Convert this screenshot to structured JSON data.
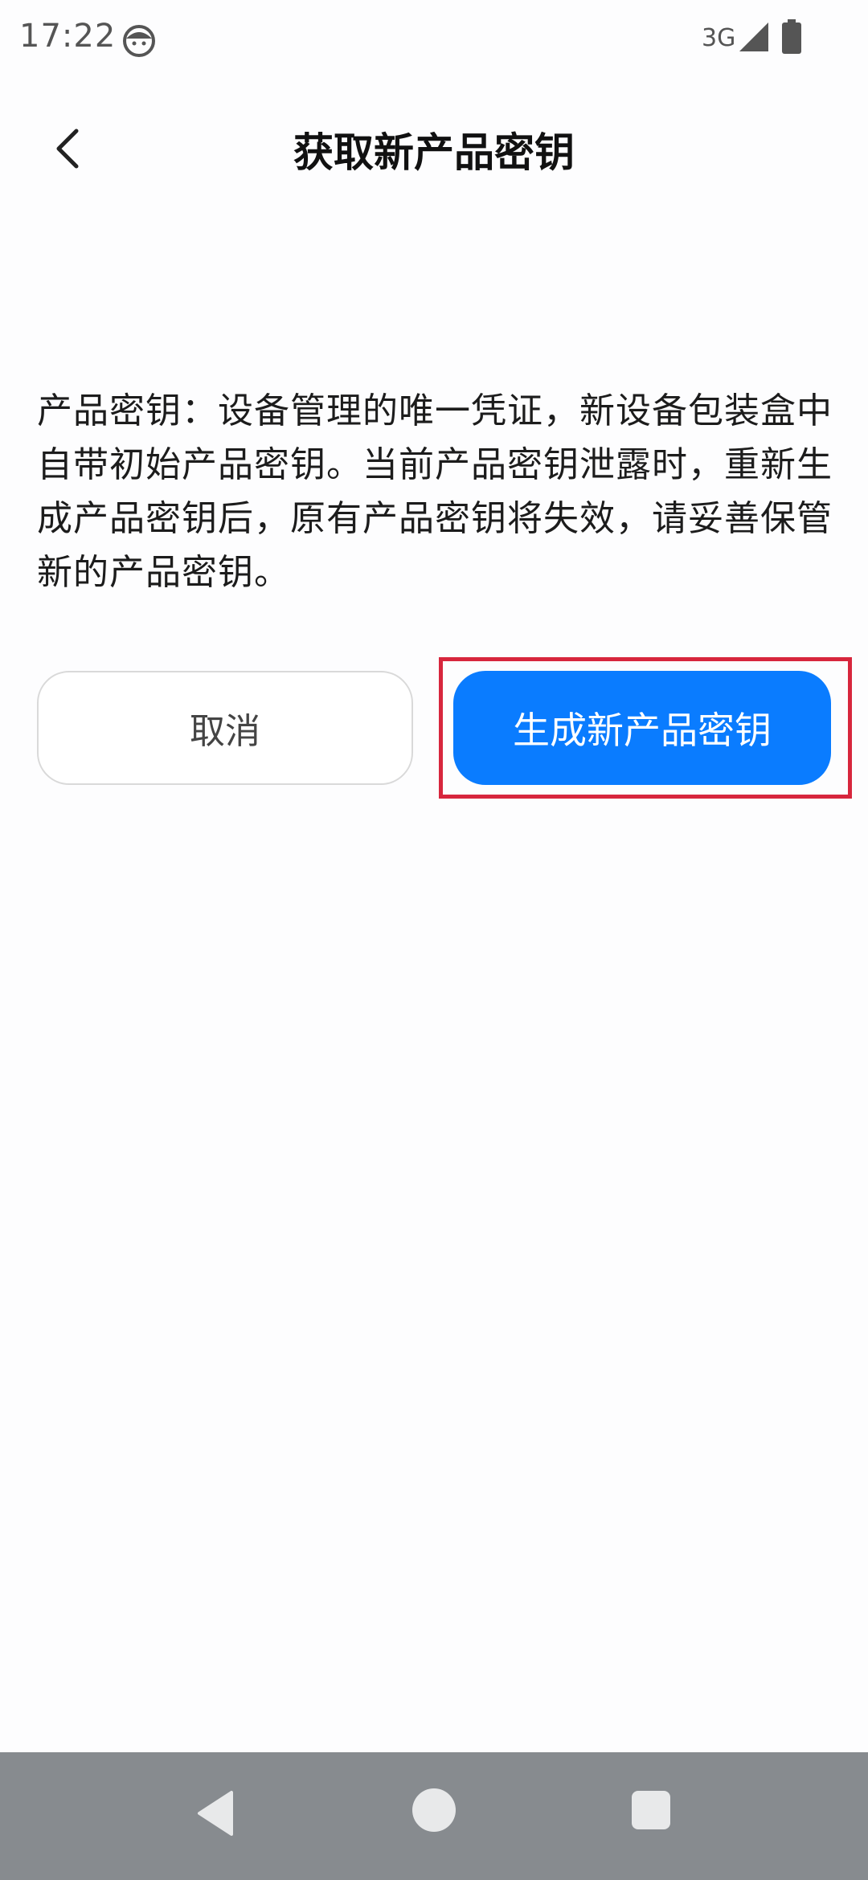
{
  "status_bar": {
    "time": "17:22",
    "network": "3G"
  },
  "header": {
    "title": "获取新产品密钥",
    "back_icon": "chevron-left-icon"
  },
  "description": "产品密钥：设备管理的唯一凭证，新设备包装盒中自带初始产品密钥。当前产品密钥泄露时，重新生成产品密钥后，原有产品密钥将失效，请妥善保管新的产品密钥。",
  "actions": {
    "cancel_label": "取消",
    "generate_label": "生成新产品密钥"
  },
  "colors": {
    "primary": "#0a7cff",
    "highlight_frame": "#d7263d",
    "nav_bar": "#878b8f"
  }
}
